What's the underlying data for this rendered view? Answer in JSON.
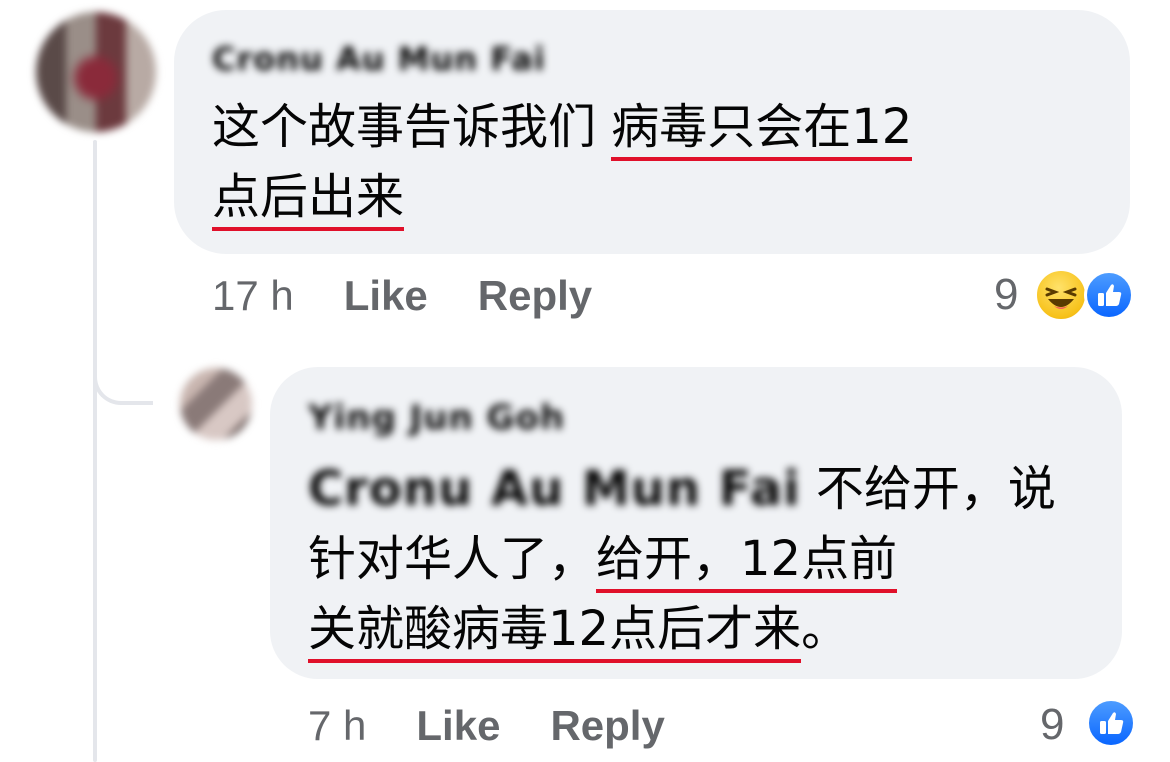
{
  "comments": [
    {
      "author": "Cronu Au Mun Fai",
      "text": {
        "lead": "这个故事告诉我们 ",
        "u1": "病毒只会在12",
        "u2": "点后出来"
      },
      "time": "17 h",
      "like_label": "Like",
      "reply_label": "Reply",
      "reaction_count": "9",
      "reaction_icons": [
        "haha-icon",
        "like-icon"
      ]
    },
    {
      "author": "Ying Jun Goh",
      "mention": "Cronu Au Mun Fai",
      "text": {
        "l1": " 不给开，说",
        "l2a": "针对华人了，",
        "l2u": "给开，12点前",
        "l3u": "关就酸病毒12点后才来",
        "l3b": "。"
      },
      "time": "7 h",
      "like_label": "Like",
      "reply_label": "Reply",
      "reaction_count": "9",
      "reaction_icons": [
        "like-icon"
      ]
    }
  ],
  "colors": {
    "bubble": "#f0f2f5",
    "meta_text": "#65676b",
    "underline": "#e0102a",
    "like_blue": "#0a66ff",
    "haha_yellow": "#f7c21b"
  }
}
